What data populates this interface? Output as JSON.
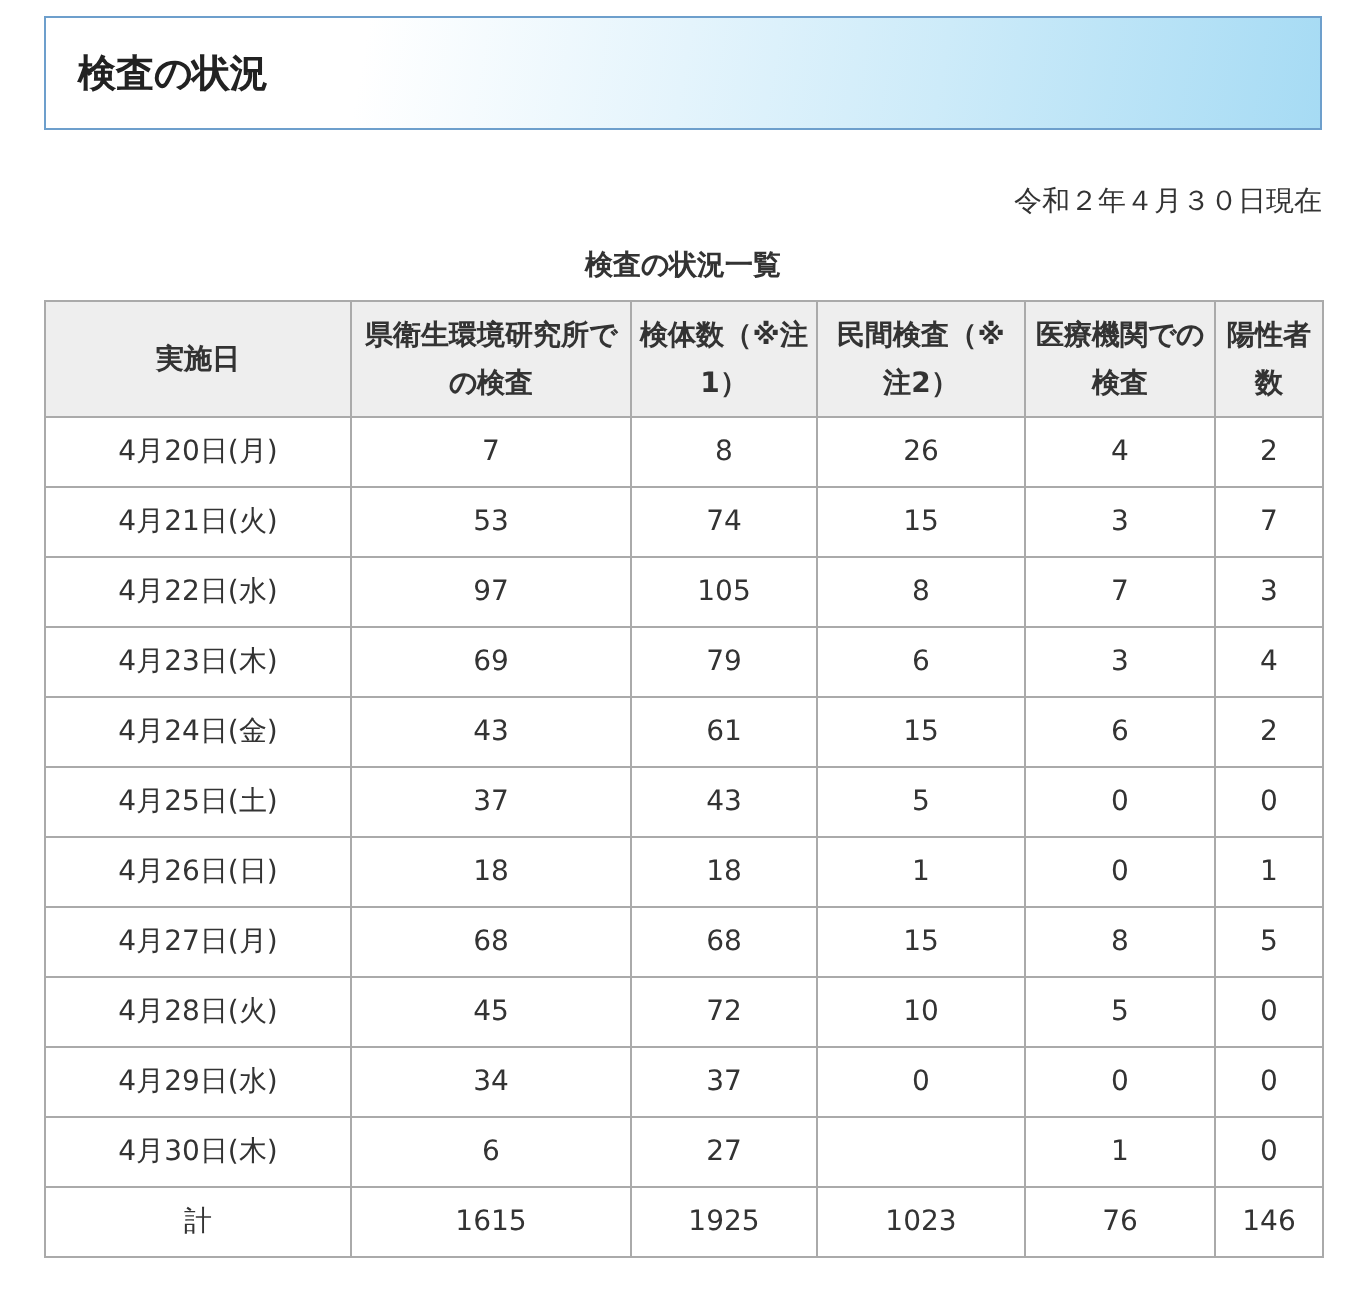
{
  "heading": "検査の状況",
  "as_of": "令和２年４月３０日現在",
  "table": {
    "caption": "検査の状況一覧",
    "columns": [
      "実施日",
      "県衛生環境研究所での検査",
      "検体数（※注1）",
      "民間検査（※注2）",
      "医療機関での検査",
      "陽性者数"
    ],
    "rows": [
      {
        "date": "4月20日(月)",
        "lab": "7",
        "specimens": "8",
        "private": "26",
        "medical": "4",
        "positive": "2"
      },
      {
        "date": "4月21日(火)",
        "lab": "53",
        "specimens": "74",
        "private": "15",
        "medical": "3",
        "positive": "7"
      },
      {
        "date": "4月22日(水)",
        "lab": "97",
        "specimens": "105",
        "private": "8",
        "medical": "7",
        "positive": "3"
      },
      {
        "date": "4月23日(木)",
        "lab": "69",
        "specimens": "79",
        "private": "6",
        "medical": "3",
        "positive": "4"
      },
      {
        "date": "4月24日(金)",
        "lab": "43",
        "specimens": "61",
        "private": "15",
        "medical": "6",
        "positive": "2"
      },
      {
        "date": "4月25日(土)",
        "lab": "37",
        "specimens": "43",
        "private": "5",
        "medical": "0",
        "positive": "0"
      },
      {
        "date": "4月26日(日)",
        "lab": "18",
        "specimens": "18",
        "private": "1",
        "medical": "0",
        "positive": "1"
      },
      {
        "date": "4月27日(月)",
        "lab": "68",
        "specimens": "68",
        "private": "15",
        "medical": "8",
        "positive": "5"
      },
      {
        "date": "4月28日(火)",
        "lab": "45",
        "specimens": "72",
        "private": "10",
        "medical": "5",
        "positive": "0"
      },
      {
        "date": "4月29日(水)",
        "lab": "34",
        "specimens": "37",
        "private": "0",
        "medical": "0",
        "positive": "0"
      },
      {
        "date": "4月30日(木)",
        "lab": "6",
        "specimens": "27",
        "medical": "1",
        "positive": "0"
      },
      {
        "date": "計",
        "lab": "1615",
        "specimens": "1925",
        "private": "1023",
        "medical": "76",
        "positive": "146"
      }
    ]
  }
}
